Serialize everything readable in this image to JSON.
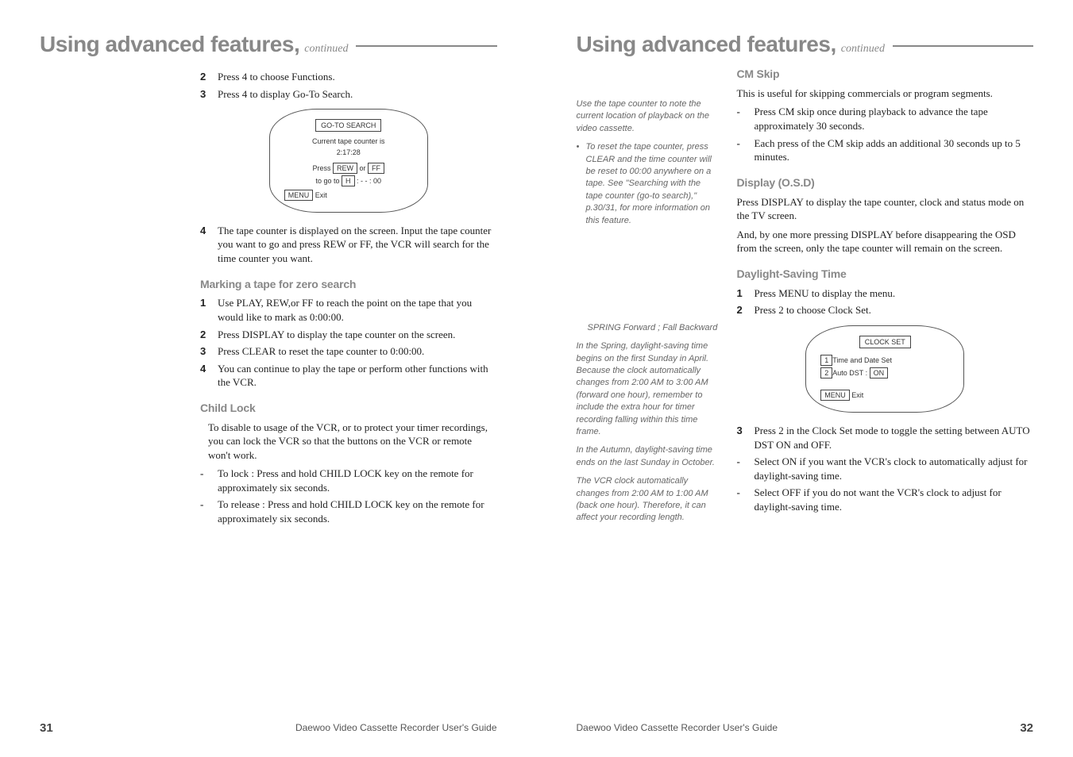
{
  "leftPage": {
    "title": "Using advanced features,",
    "cont": "continued",
    "steps12": [
      {
        "n": "2",
        "t": "Press 4 to choose Functions."
      },
      {
        "n": "3",
        "t": "Press 4 to display Go-To Search."
      }
    ],
    "osd1": {
      "header": "GO-TO SEARCH",
      "l1": "Current tape counter is",
      "l2": "2:17:28",
      "l3a": "Press ",
      "l3b": "REW",
      "l3c": " or ",
      "l3d": "FF",
      "l4a": "to go to ",
      "l4b": "H",
      "l4c": " : - - : 00",
      "l5a": "MENU",
      "l5b": " Exit"
    },
    "step4": {
      "n": "4",
      "t": "The tape counter is displayed on the screen. Input the tape counter you want to go and press REW or FF, the VCR will search for the time counter you want."
    },
    "markingHead": "Marking a tape for zero search",
    "markingSteps": [
      {
        "n": "1",
        "t": "Use PLAY, REW,or FF to reach the point on the tape that you would like to mark as 0:00:00."
      },
      {
        "n": "2",
        "t": "Press DISPLAY to display  the tape counter on the screen."
      },
      {
        "n": "3",
        "t": "Press CLEAR to reset the tape counter to 0:00:00."
      },
      {
        "n": "4",
        "t": "You can continue to play the tape or perform other functions with the VCR."
      }
    ],
    "childHead": "Child Lock",
    "childIntro": "To disable to usage of the VCR, or to protect your timer recordings, you can lock the VCR so that the buttons on the VCR or remote won't work.",
    "childItems": [
      "To lock : Press and hold CHILD LOCK key on the remote for approximately six seconds.",
      "To release : Press and hold CHILD LOCK key on the remote for approximately six seconds."
    ],
    "footer": "Daewoo Video Cassette Recorder User's Guide",
    "pg": "31"
  },
  "rightPage": {
    "title": "Using advanced features,",
    "cont": "continued",
    "side1a": "Use the tape counter to note the current location of playback on the video cassette.",
    "side1b": "To reset the tape counter, press CLEAR and the time counter will be reset to 00:00 anywhere on a tape. See \"Searching with the tape counter (go-to search),\" p.30/31, for more information on this feature.",
    "side2head": "SPRING Forward ; Fall Backward",
    "side2a": "In the Spring, daylight-saving time begins on the first Sunday in April. Because the clock automatically changes from 2:00 AM to 3:00 AM (forward one hour), remember to include the extra hour for timer recording falling within this time frame.",
    "side2b": "In the Autumn, daylight-saving time ends on the last Sunday in October.",
    "side2c": "The VCR clock automatically changes from 2:00 AM to 1:00 AM (back one hour). Therefore, it can affect your recording length.",
    "cmHead": "CM Skip",
    "cmIntro": "This is useful for skipping commercials or program segments.",
    "cmItems": [
      "Press CM skip once during playback to advance the tape approximately 30 seconds.",
      "Each press of the CM skip adds an additional 30 seconds up to 5 minutes."
    ],
    "dispHead": "Display (O.S.D)",
    "disp1": "Press DISPLAY to display the tape counter, clock and status mode on the TV screen.",
    "disp2": "And, by one more pressing DISPLAY before disappearing the OSD from the screen, only the tape counter will remain on the screen.",
    "dstHead": "Daylight-Saving Time",
    "dstSteps12": [
      {
        "n": "1",
        "t": "Press MENU to display the menu."
      },
      {
        "n": "2",
        "t": "Press 2 to choose Clock Set."
      }
    ],
    "osd2": {
      "header": "CLOCK SET",
      "l1a": "1",
      "l1b": "Time and Date Set",
      "l2a": "2",
      "l2b": "Auto DST :   ",
      "l2c": "ON",
      "l3a": "MENU",
      "l3b": " Exit"
    },
    "dstStep3": {
      "n": "3",
      "t": "Press 2 in the Clock Set mode to toggle the setting between AUTO DST ON and OFF."
    },
    "dstDashes": [
      "Select ON if you want the VCR's clock to automatically adjust for daylight-saving time.",
      "Select OFF if you do not want the VCR's clock to adjust for daylight-saving time."
    ],
    "footer": "Daewoo Video Cassette Recorder User's Guide",
    "pg": "32"
  }
}
